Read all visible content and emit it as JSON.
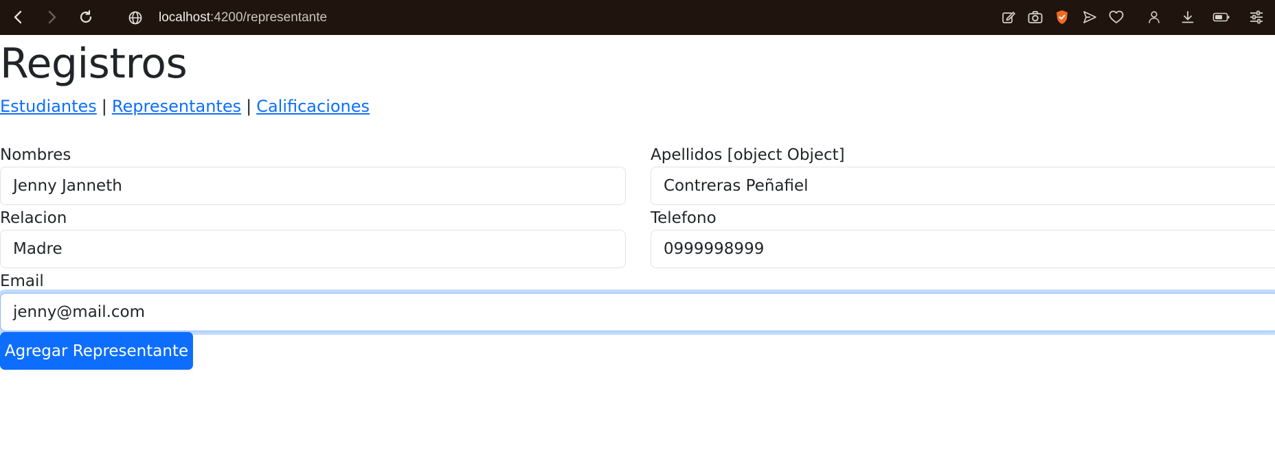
{
  "browser": {
    "url_host": "localhost",
    "url_path": ":4200/representante"
  },
  "page": {
    "title": "Registros",
    "links": [
      {
        "label": "Estudiantes"
      },
      {
        "label": "Representantes"
      },
      {
        "label": "Calificaciones"
      }
    ],
    "separator": "|"
  },
  "form": {
    "nombres": {
      "label": "Nombres",
      "value": "Jenny Janneth"
    },
    "apellidos": {
      "label": "Apellidos [object Object]",
      "value": "Contreras Peñafiel"
    },
    "relacion": {
      "label": "Relacion",
      "value": "Madre"
    },
    "telefono": {
      "label": "Telefono",
      "value": "0999998999"
    },
    "email": {
      "label": "Email",
      "value": "jenny@mail.com"
    },
    "submit_label": "Agregar Representante"
  },
  "colors": {
    "topbar": "#1f140e",
    "link": "#0d6efd",
    "primary": "#0d6efd",
    "brave_shield": "#f26b21"
  }
}
